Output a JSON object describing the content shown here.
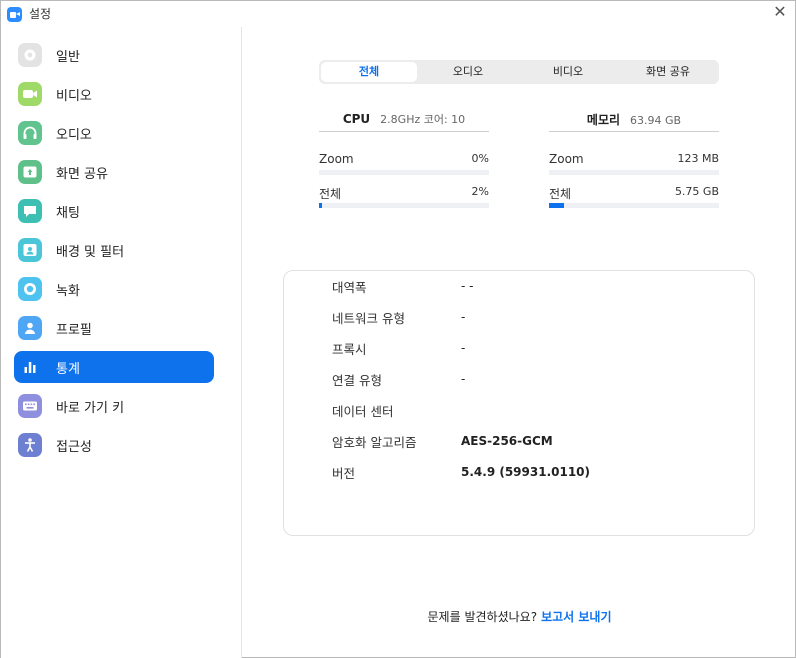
{
  "window": {
    "title": "설정"
  },
  "colors": {
    "accent": "#0e72ed"
  },
  "sidebar": {
    "items": [
      {
        "label": "일반",
        "icon": "gear-icon",
        "color": "#e3e3e3",
        "active": false
      },
      {
        "label": "비디오",
        "icon": "video-camera-icon",
        "color": "#9fd967",
        "active": false
      },
      {
        "label": "오디오",
        "icon": "headphones-icon",
        "color": "#61c38e",
        "active": false
      },
      {
        "label": "화면 공유",
        "icon": "share-screen-icon",
        "color": "#5fc089",
        "active": false
      },
      {
        "label": "채팅",
        "icon": "chat-bubble-icon",
        "color": "#3dbfb3",
        "active": false
      },
      {
        "label": "배경 및 필터",
        "icon": "background-portrait-icon",
        "color": "#4bc6d9",
        "active": false
      },
      {
        "label": "녹화",
        "icon": "record-icon",
        "color": "#4fc3f0",
        "active": false
      },
      {
        "label": "프로필",
        "icon": "profile-icon",
        "color": "#4fa6f5",
        "active": false
      },
      {
        "label": "통계",
        "icon": "statistics-bar-icon",
        "color": "#0e72ed",
        "active": true
      },
      {
        "label": "바로 가기 키",
        "icon": "keyboard-icon",
        "color": "#8f8fe0",
        "active": false
      },
      {
        "label": "접근성",
        "icon": "accessibility-icon",
        "color": "#6d7fd1",
        "active": false
      }
    ]
  },
  "tabs": [
    {
      "label": "전체",
      "active": true
    },
    {
      "label": "오디오",
      "active": false
    },
    {
      "label": "비디오",
      "active": false
    },
    {
      "label": "화면 공유",
      "active": false
    }
  ],
  "cpu": {
    "title": "CPU",
    "summary": "2.8GHz 코어: 10",
    "rows": [
      {
        "label": "Zoom",
        "value": "0%",
        "level": 0
      },
      {
        "label": "전체",
        "value": "2%",
        "level": 0.02
      }
    ]
  },
  "memory": {
    "title": "메모리",
    "summary": "63.94 GB",
    "rows": [
      {
        "label": "Zoom",
        "value": "123 MB",
        "level": 0
      },
      {
        "label": "전체",
        "value": "5.75 GB",
        "level": 0.09
      }
    ]
  },
  "info": [
    {
      "label": "대역폭",
      "value": "-   -",
      "bold": false
    },
    {
      "label": "네트워크 유형",
      "value": "-",
      "bold": false
    },
    {
      "label": "프록시",
      "value": "-",
      "bold": false
    },
    {
      "label": "연결 유형",
      "value": "-",
      "bold": false
    },
    {
      "label": "데이터 센터",
      "value": "",
      "bold": false
    },
    {
      "label": "암호화 알고리즘",
      "value": "AES-256-GCM",
      "bold": true
    },
    {
      "label": "버전",
      "value": "5.4.9 (59931.0110)",
      "bold": true
    }
  ],
  "footer": {
    "question": "문제를 발견하셨나요?",
    "link": "보고서 보내기"
  }
}
